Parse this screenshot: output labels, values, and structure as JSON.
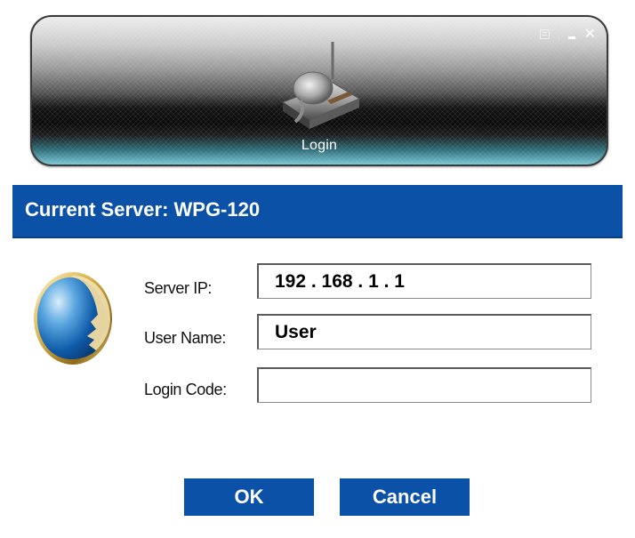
{
  "toolbar": {
    "label": "Login",
    "menu_icon": "menu-icon",
    "minimize_icon": "minimize-icon",
    "close_icon": "close-icon",
    "close_glyph": "✕",
    "device_icon": "wireless-presentation-gateway-icon"
  },
  "dialog": {
    "title": "Current Server: WPG-120",
    "avatar_icon": "speaking-head-icon",
    "fields": {
      "server_ip": {
        "label": "Server IP:",
        "value": "192 . 168 . 1 . 1"
      },
      "user_name": {
        "label": "User Name:",
        "value": "User"
      },
      "login_code": {
        "label": "Login Code:",
        "value": ""
      }
    },
    "buttons": {
      "ok": "OK",
      "cancel": "Cancel"
    }
  },
  "colors": {
    "header_blue": "#0a51a7",
    "button_blue": "#0a51a7",
    "toolbar_dark": "#121212",
    "toolbar_glow": "#79c6d6"
  }
}
